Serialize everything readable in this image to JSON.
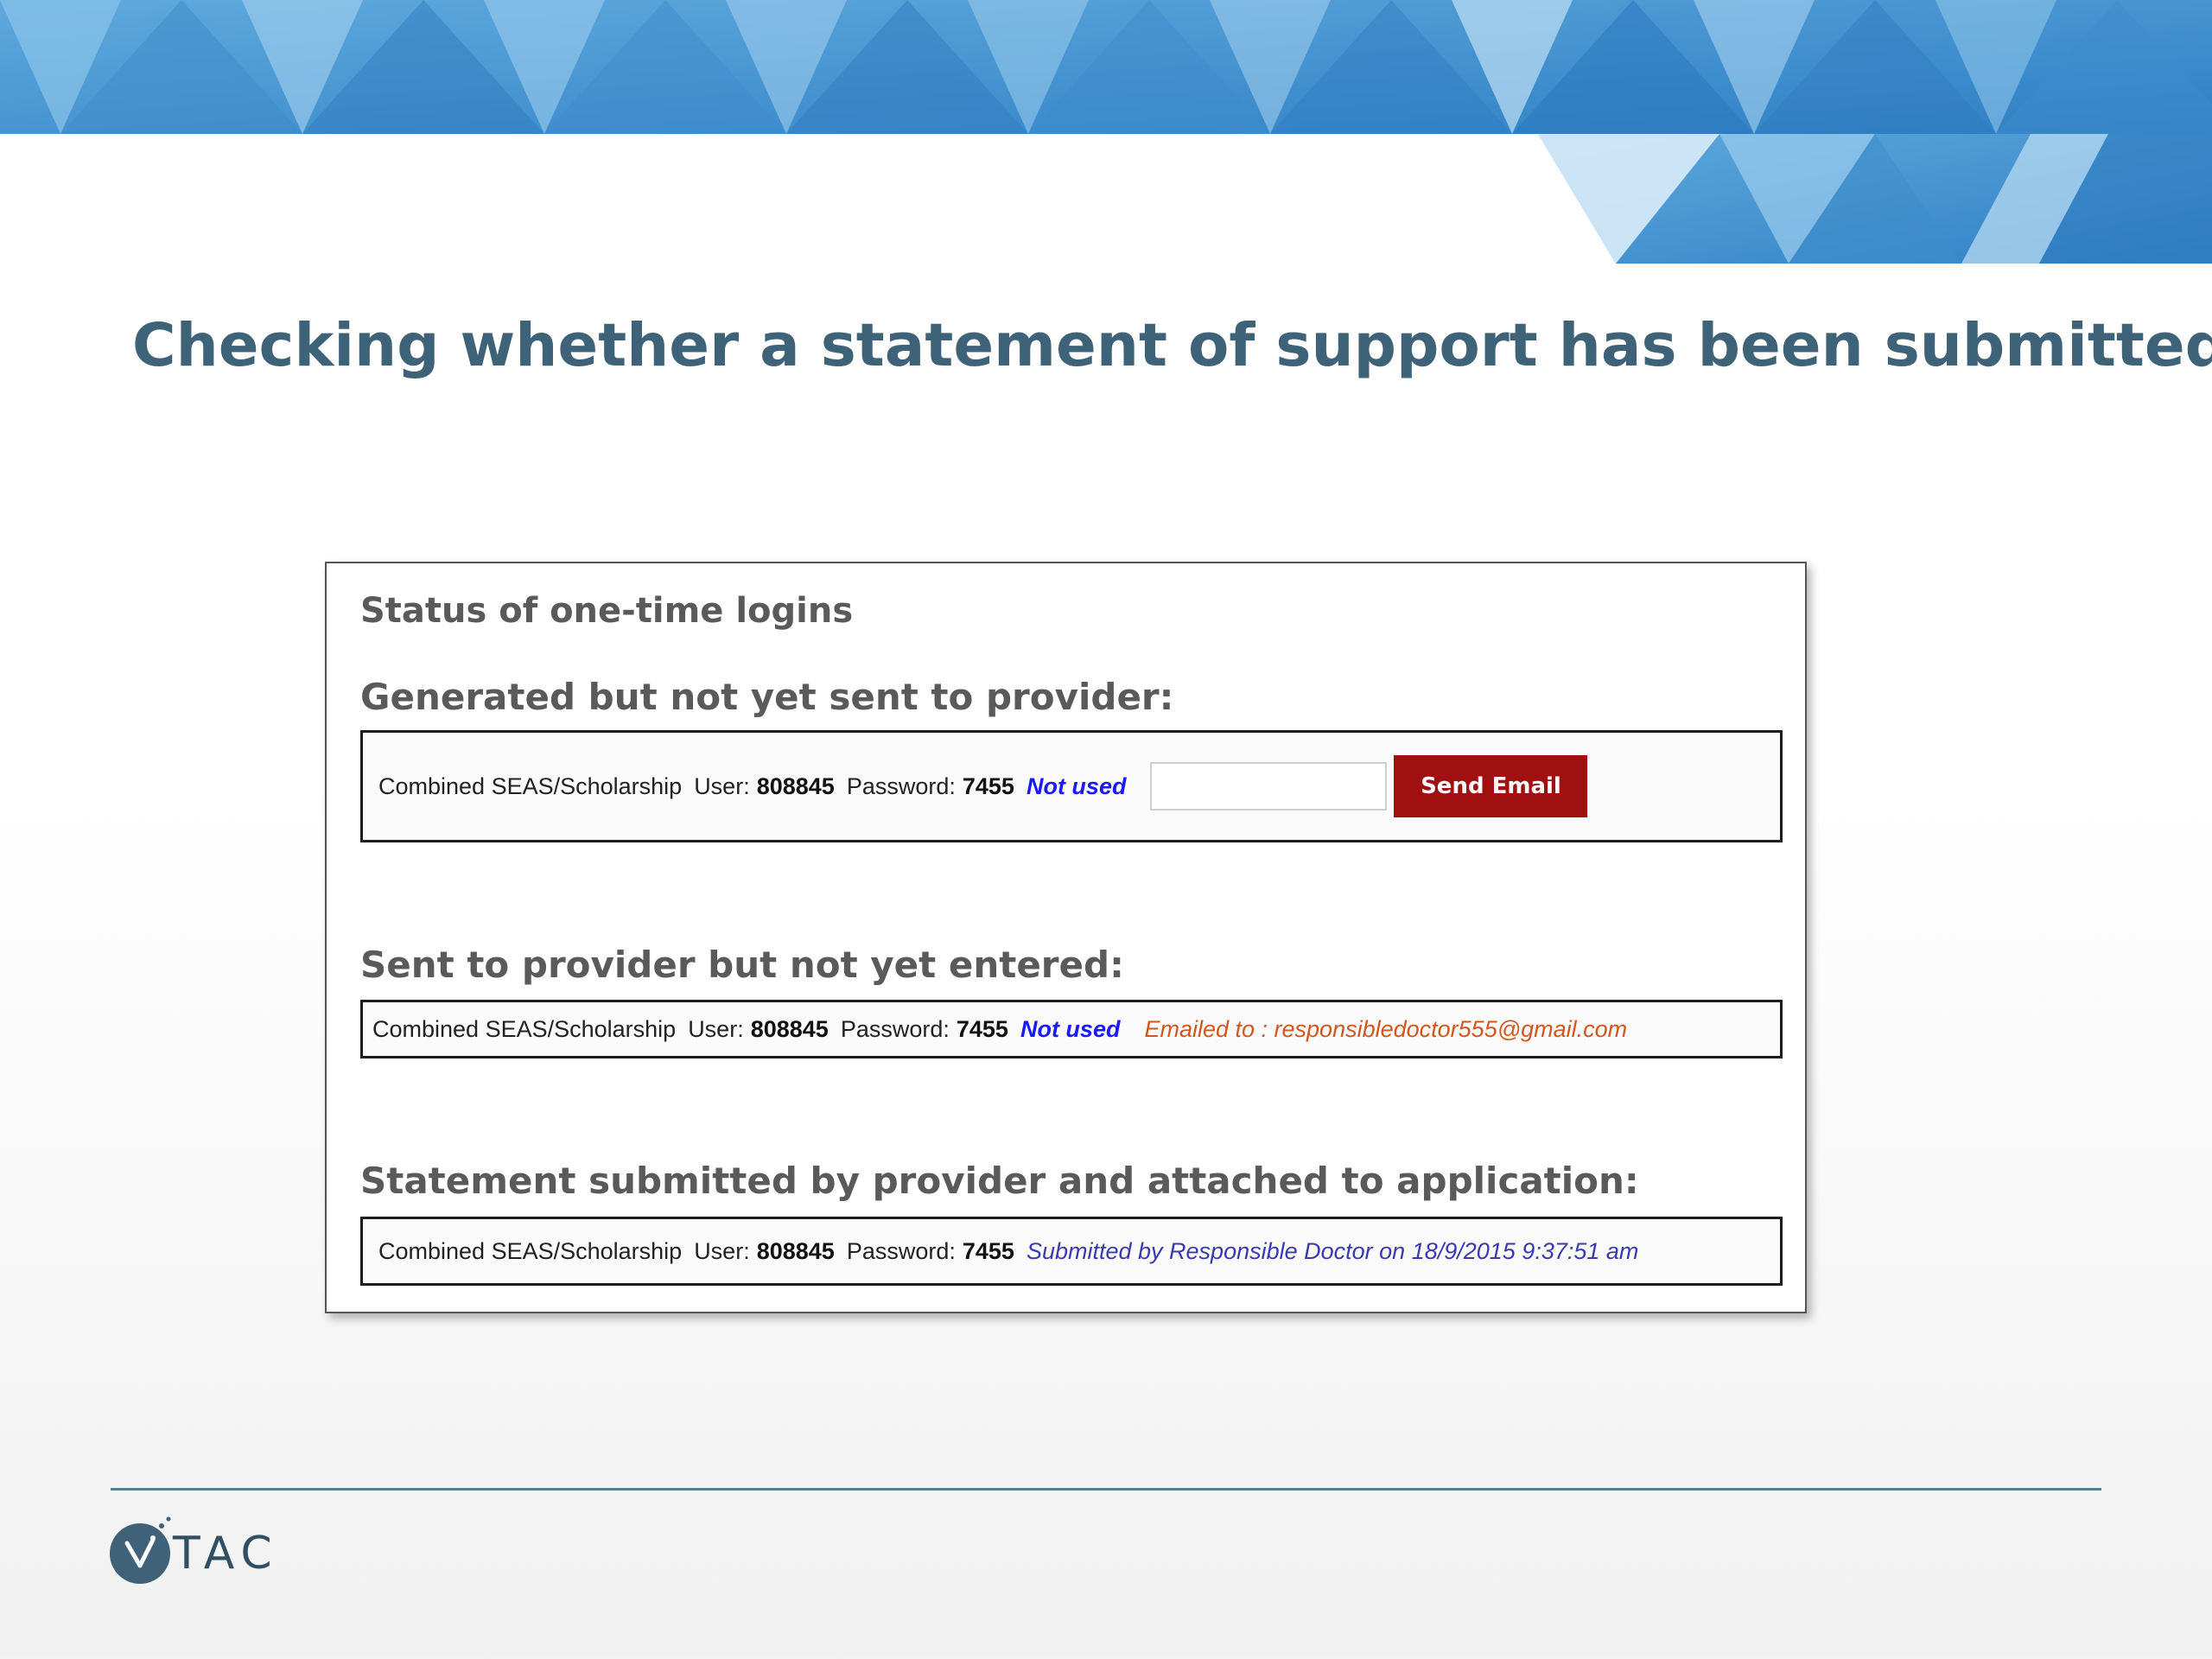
{
  "slide": {
    "title": "Checking whether a statement of support has been submitted"
  },
  "panel": {
    "heading": "Status of one-time logins",
    "generated": {
      "heading": "Generated but not yet sent to provider:",
      "login_type": "Combined SEAS/Scholarship",
      "user_label": "User:",
      "user_value": "808845",
      "password_label": "Password:",
      "password_value": "7455",
      "status": "Not used",
      "email_input_value": "",
      "send_button_label": "Send Email"
    },
    "sent": {
      "heading": "Sent to provider but not yet entered:",
      "login_type": "Combined SEAS/Scholarship",
      "user_label": "User:",
      "user_value": "808845",
      "password_label": "Password:",
      "password_value": "7455",
      "status": "Not used",
      "emailed_to": "Emailed to : responsibledoctor555@gmail.com"
    },
    "submitted": {
      "heading": "Statement submitted by provider and attached to application:",
      "login_type": "Combined SEAS/Scholarship",
      "user_label": "User:",
      "user_value": "808845",
      "password_label": "Password:",
      "password_value": "7455",
      "status": "Submitted by Responsible Doctor on 18/9/2015 9:37:51 am"
    }
  },
  "footer": {
    "logo_text": "TAC"
  },
  "colors": {
    "title": "#3e6379",
    "send_button": "#a01010",
    "not_used": "#1a1aff",
    "emailed": "#d2571f",
    "submitted": "#3a3ab0"
  }
}
